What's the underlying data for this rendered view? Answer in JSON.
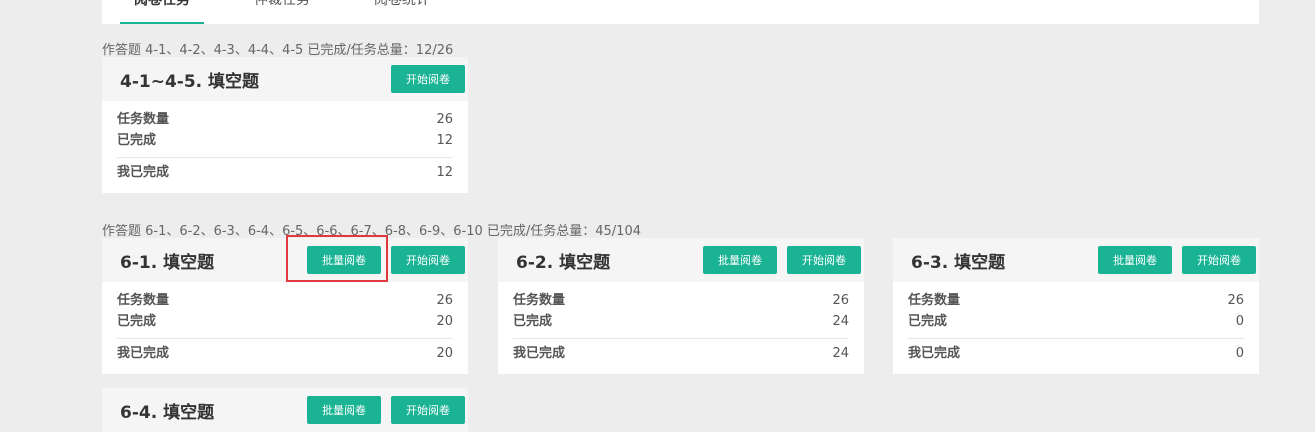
{
  "tabs": [
    {
      "label": "阅卷任务",
      "active": true
    },
    {
      "label": "仲裁任务",
      "active": false
    },
    {
      "label": "阅卷统计",
      "active": false
    }
  ],
  "groups": [
    {
      "label": "作答题 4-1、4-2、4-3、4-4、4-5   已完成/任务总量：12/26",
      "cards": [
        {
          "title": "4-1~4-5. 填空题",
          "start": "开始阅卷",
          "total_label": "任务数量",
          "total": "26",
          "done_label": "已完成",
          "done": "12",
          "mine_label": "我已完成",
          "mine": "12"
        }
      ]
    },
    {
      "label": "作答题 6-1、6-2、6-3、6-4、6-5、6-6、6-7、6-8、6-9、6-10   已完成/任务总量：45/104",
      "cards": [
        {
          "title": "6-1. 填空题",
          "batch": "批量阅卷",
          "start": "开始阅卷",
          "total_label": "任务数量",
          "total": "26",
          "done_label": "已完成",
          "done": "20",
          "mine_label": "我已完成",
          "mine": "20"
        },
        {
          "title": "6-2. 填空题",
          "batch": "批量阅卷",
          "start": "开始阅卷",
          "total_label": "任务数量",
          "total": "26",
          "done_label": "已完成",
          "done": "24",
          "mine_label": "我已完成",
          "mine": "24"
        },
        {
          "title": "6-3. 填空题",
          "batch": "批量阅卷",
          "start": "开始阅卷",
          "total_label": "任务数量",
          "total": "26",
          "done_label": "已完成",
          "done": "0",
          "mine_label": "我已完成",
          "mine": "0"
        },
        {
          "title": "6-4. 填空题",
          "batch": "批量阅卷",
          "start": "开始阅卷"
        }
      ]
    }
  ],
  "colors": {
    "accent": "#1ab394",
    "highlight": "#e0393e"
  }
}
